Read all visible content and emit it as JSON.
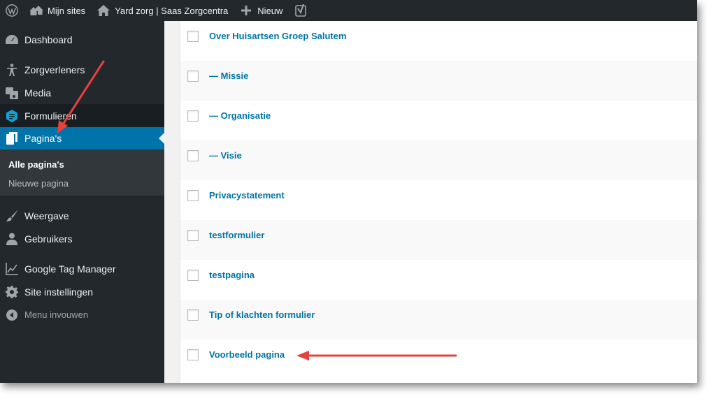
{
  "adminbar": {
    "wp_icon": "wordpress-icon",
    "my_sites": "Mijn sites",
    "site_name": "Yard zorg | Saas Zorgcentra",
    "new": "Nieuw",
    "seo_icon": "yoast-icon"
  },
  "sidebar": {
    "items": [
      {
        "label": "Dashboard",
        "icon": "dashboard-icon"
      },
      {
        "label": "Zorgverleners",
        "icon": "person-icon"
      },
      {
        "label": "Media",
        "icon": "media-icon"
      },
      {
        "label": "Formulieren",
        "icon": "forms-icon"
      },
      {
        "label": "Pagina's",
        "icon": "pages-icon"
      },
      {
        "label": "Weergave",
        "icon": "brush-icon"
      },
      {
        "label": "Gebruikers",
        "icon": "users-icon"
      },
      {
        "label": "Google Tag Manager",
        "icon": "chart-icon"
      },
      {
        "label": "Site instellingen",
        "icon": "gear-icon"
      },
      {
        "label": "Menu invouwen",
        "icon": "collapse-icon"
      }
    ],
    "submenu": {
      "current": "Alle pagina's",
      "other": "Nieuwe pagina"
    }
  },
  "pages": [
    "Over Huisartsen Groep Salutem",
    "— Missie",
    "— Organisatie",
    "— Visie",
    "Privacystatement",
    "testformulier",
    "testpagina",
    "Tip of klachten formulier",
    "Voorbeeld pagina"
  ],
  "colors": {
    "accent": "#0073aa",
    "sidebar": "#23282d",
    "arrow": "#e8413c"
  }
}
